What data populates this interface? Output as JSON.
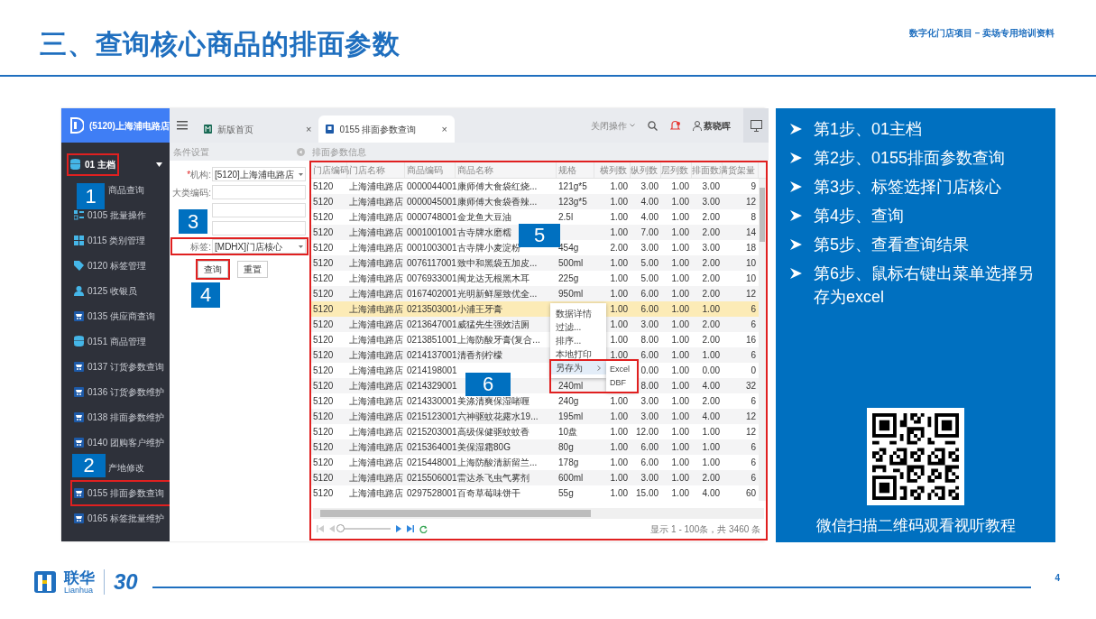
{
  "slide": {
    "title": "三、查询核心商品的排面参数",
    "subtitle": "数字化门店项目 – 卖场专用培训资料",
    "page_number": "4"
  },
  "app": {
    "store": "(5120)上海浦电路店",
    "nav_group": {
      "label": "01 主档",
      "expanded": true,
      "highlighted": true
    },
    "nav_items": [
      {
        "label": "商品查询",
        "kind": "none",
        "highlighted": false
      },
      {
        "label": "0105 批量操作",
        "kind": "batch",
        "highlighted": false
      },
      {
        "label": "0115 类别管理",
        "kind": "grid",
        "highlighted": false
      },
      {
        "label": "0120 标签管理",
        "kind": "tag",
        "highlighted": false
      },
      {
        "label": "0125 收银员",
        "kind": "person",
        "highlighted": false
      },
      {
        "label": "0135 供应商查询",
        "kind": "cart",
        "highlighted": false
      },
      {
        "label": "0151 商品管理",
        "kind": "db",
        "highlighted": false
      },
      {
        "label": "0137 订货参数查询",
        "kind": "cart",
        "highlighted": false
      },
      {
        "label": "0136 订货参数维护",
        "kind": "cart",
        "highlighted": false
      },
      {
        "label": "0138 排面参数维护",
        "kind": "cart",
        "highlighted": false
      },
      {
        "label": "0140 团购客户维护",
        "kind": "cart",
        "highlighted": false
      },
      {
        "label": "产地修改",
        "kind": "none",
        "highlighted": false
      },
      {
        "label": "0155 排面参数查询",
        "kind": "cart",
        "highlighted": true
      },
      {
        "label": "0165 标签批量维护",
        "kind": "cart",
        "highlighted": false
      }
    ],
    "tabs": [
      {
        "label": "新版首页",
        "close": "×",
        "selected": false
      },
      {
        "label": "0155 排面参数查询",
        "close": "×",
        "selected": true
      }
    ],
    "toolbar": {
      "close_ops": "关闭操作",
      "user": "蔡晓晖"
    },
    "form": {
      "title": "条件设置",
      "fields": [
        {
          "label": "机构:",
          "marker": "*",
          "kind": "select",
          "value": "[5120]上海浦电路店",
          "highlighted": false
        },
        {
          "label": "大类编码:",
          "kind": "input",
          "highlighted": false
        },
        {
          "kind": "input",
          "highlighted": false
        },
        {
          "kind": "input",
          "highlighted": false
        },
        {
          "label": "标签:",
          "kind": "select",
          "value": "[MDHX]门店核心",
          "highlighted": true
        }
      ],
      "buttons": [
        {
          "label": "查询",
          "highlighted": true
        },
        {
          "label": "重置",
          "highlighted": false
        }
      ]
    },
    "table": {
      "title": "排面参数信息",
      "highlighted": true,
      "columns": [
        "门店编码",
        "门店名称",
        "商品编码",
        "商品名称",
        "规格",
        "横列数",
        "纵列数",
        "层列数",
        "排面数",
        "满货架量"
      ],
      "rows": [
        {
          "selected": false,
          "cells": [
            "5120",
            "上海浦电路店",
            "0000044001",
            "康师傅大食袋红烧...",
            "121g*5",
            "1.00",
            "3.00",
            "1.00",
            "3.00",
            "9"
          ]
        },
        {
          "selected": false,
          "cells": [
            "5120",
            "上海浦电路店",
            "0000045001",
            "康师傅大食袋香辣...",
            "123g*5",
            "1.00",
            "4.00",
            "1.00",
            "3.00",
            "12"
          ]
        },
        {
          "selected": false,
          "cells": [
            "5120",
            "上海浦电路店",
            "0000748001",
            "金龙鱼大豆油",
            "2.5l",
            "1.00",
            "4.00",
            "1.00",
            "2.00",
            "8"
          ]
        },
        {
          "selected": false,
          "cells": [
            "5120",
            "上海浦电路店",
            "0001001001",
            "古寺牌水磨糯",
            null,
            "1.00",
            "7.00",
            "1.00",
            "2.00",
            "14"
          ]
        },
        {
          "selected": false,
          "cells": [
            "5120",
            "上海浦电路店",
            "0001003001",
            "古寺牌小麦淀粉",
            "454g",
            "2.00",
            "3.00",
            "1.00",
            "3.00",
            "18"
          ]
        },
        {
          "selected": false,
          "cells": [
            "5120",
            "上海浦电路店",
            "0076117001",
            "致中和黑袋五加皮...",
            "500ml",
            "1.00",
            "5.00",
            "1.00",
            "2.00",
            "10"
          ]
        },
        {
          "selected": false,
          "cells": [
            "5120",
            "上海浦电路店",
            "0076933001",
            "闽龙达无根黑木耳",
            "225g",
            "1.00",
            "5.00",
            "1.00",
            "2.00",
            "10"
          ]
        },
        {
          "selected": false,
          "cells": [
            "5120",
            "上海浦电路店",
            "0167402001",
            "光明新鲜屋致优全...",
            "950ml",
            "1.00",
            "6.00",
            "1.00",
            "2.00",
            "12"
          ]
        },
        {
          "selected": true,
          "cells": [
            "5120",
            "上海浦电路店",
            "0213503001",
            "小浦王牙膏",
            null,
            "1.00",
            "6.00",
            "1.00",
            "1.00",
            "6"
          ]
        },
        {
          "selected": false,
          "cells": [
            "5120",
            "上海浦电路店",
            "0213647001",
            "威猛先生强效洁厕",
            null,
            "1.00",
            "3.00",
            "1.00",
            "2.00",
            "6"
          ]
        },
        {
          "selected": false,
          "cells": [
            "5120",
            "上海浦电路店",
            "0213851001",
            "上海防酸牙膏(复合...",
            null,
            "1.00",
            "8.00",
            "1.00",
            "2.00",
            "16"
          ]
        },
        {
          "selected": false,
          "cells": [
            "5120",
            "上海浦电路店",
            "0214137001",
            "清香剂柠檬",
            null,
            "1.00",
            "6.00",
            "1.00",
            "1.00",
            "6"
          ]
        },
        {
          "selected": false,
          "cells": [
            "5120",
            "上海浦电路店",
            "0214198001",
            null,
            null,
            null,
            "0.00",
            "1.00",
            "0.00",
            "0"
          ]
        },
        {
          "selected": false,
          "cells": [
            "5120",
            "上海浦电路店",
            "0214329001",
            null,
            "240ml",
            null,
            "8.00",
            "1.00",
            "4.00",
            "32"
          ]
        },
        {
          "selected": false,
          "cells": [
            "5120",
            "上海浦电路店",
            "0214330001",
            "美涤清爽保湿啫喱",
            "240g",
            "1.00",
            "3.00",
            "1.00",
            "2.00",
            "6"
          ]
        },
        {
          "selected": false,
          "cells": [
            "5120",
            "上海浦电路店",
            "0215123001",
            "六神驱蚊花露水19...",
            "195ml",
            "1.00",
            "3.00",
            "1.00",
            "4.00",
            "12"
          ]
        },
        {
          "selected": false,
          "cells": [
            "5120",
            "上海浦电路店",
            "0215203001",
            "高级保健驱蚊蚊香",
            "10盘",
            "1.00",
            "12.00",
            "1.00",
            "1.00",
            "12"
          ]
        },
        {
          "selected": false,
          "cells": [
            "5120",
            "上海浦电路店",
            "0215364001",
            "美保湿霜80G",
            "80g",
            "1.00",
            "6.00",
            "1.00",
            "1.00",
            "6"
          ]
        },
        {
          "selected": false,
          "cells": [
            "5120",
            "上海浦电路店",
            "0215448001",
            "上海防酸清新留兰...",
            "178g",
            "1.00",
            "6.00",
            "1.00",
            "1.00",
            "6"
          ]
        },
        {
          "selected": false,
          "cells": [
            "5120",
            "上海浦电路店",
            "0215506001",
            "雷达杀飞虫气雾剂",
            "600ml",
            "1.00",
            "3.00",
            "1.00",
            "2.00",
            "6"
          ]
        },
        {
          "selected": false,
          "cells": [
            "5120",
            "上海浦电路店",
            "0297528001",
            "百奇草莓味饼干",
            "55g",
            "1.00",
            "15.00",
            "1.00",
            "4.00",
            "60"
          ]
        }
      ],
      "pager": {
        "level": 0,
        "summary": "显示 1 - 100条，共 3460 条"
      }
    },
    "context_menu": {
      "items": [
        {
          "label": "数据详情",
          "submenu": false,
          "selected": false
        },
        {
          "label": "过滤...",
          "submenu": false,
          "selected": false
        },
        {
          "label": "排序...",
          "submenu": false,
          "selected": false
        },
        {
          "label": "本地打印",
          "submenu": false,
          "selected": false
        },
        {
          "label": "另存为",
          "submenu": true,
          "selected": true
        }
      ],
      "submenu": [
        "Excel",
        "DBF"
      ],
      "highlighted": true
    },
    "badges": [
      "1",
      "2",
      "3",
      "4",
      "5",
      "6"
    ]
  },
  "steps": [
    "第1步、01主档",
    "第2步、0155排面参数查询",
    "第3步、标签选择门店核心",
    "第4步、查询",
    "第5步、查看查询结果",
    "第6步、鼠标右键出菜单选择另存为excel"
  ],
  "qr_caption": "微信扫描二维码观看视听教程",
  "footer": {
    "brand": "联华",
    "brand_latin": "Lianhua",
    "anniversary": "30"
  }
}
